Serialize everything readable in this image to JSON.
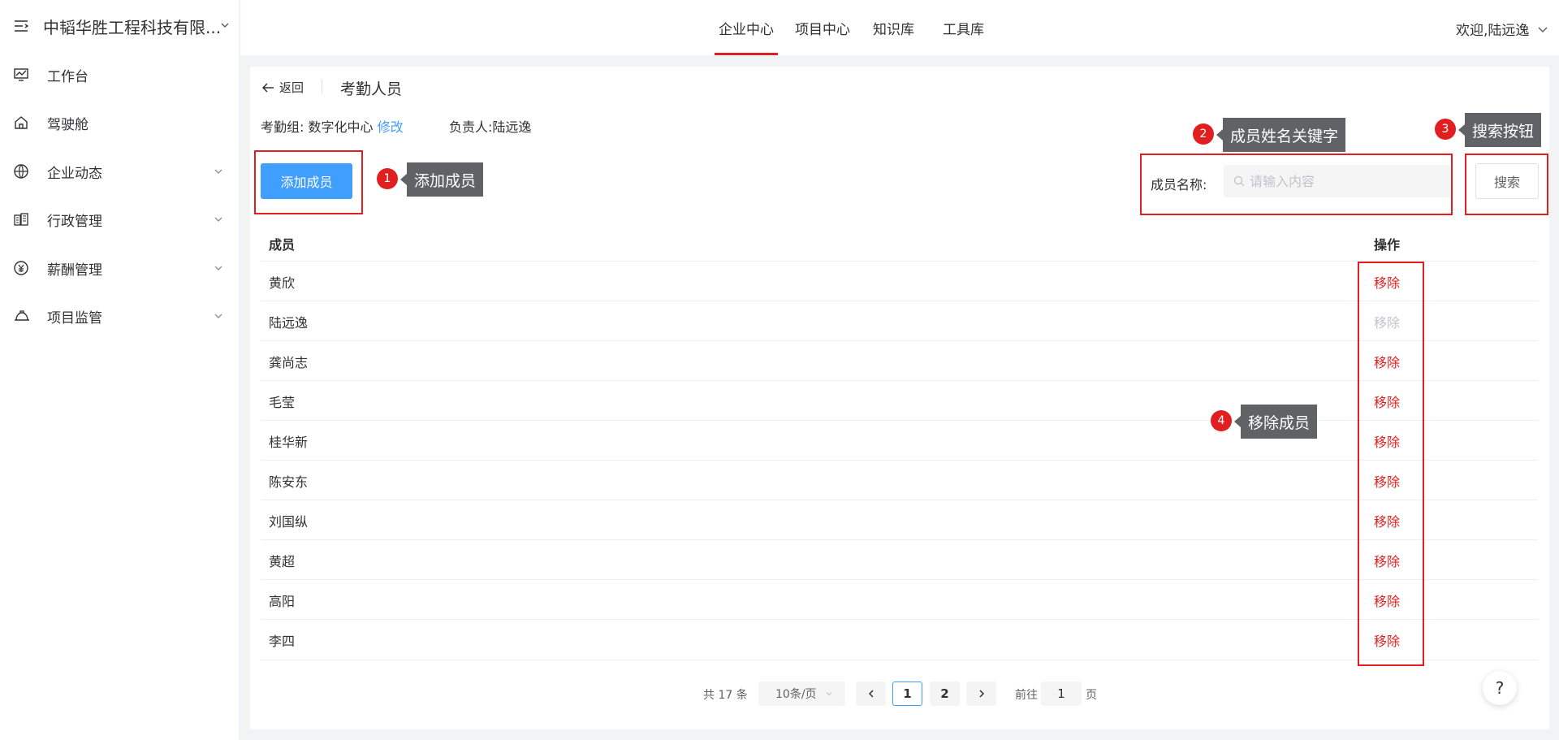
{
  "company": {
    "name": "中韬华胜工程科技有限..."
  },
  "sidebar": {
    "items": [
      {
        "label": "工作台",
        "icon": "monitor-chart-icon",
        "expandable": false
      },
      {
        "label": "驾驶舱",
        "icon": "home-icon",
        "expandable": false
      },
      {
        "label": "企业动态",
        "icon": "globe-icon",
        "expandable": true
      },
      {
        "label": "行政管理",
        "icon": "building-icon",
        "expandable": true
      },
      {
        "label": "薪酬管理",
        "icon": "salary-icon",
        "expandable": true
      },
      {
        "label": "项目监管",
        "icon": "hard-hat-icon",
        "expandable": true
      }
    ]
  },
  "topnav": {
    "tabs": [
      {
        "label": "企业中心",
        "active": true
      },
      {
        "label": "项目中心",
        "active": false
      },
      {
        "label": "知识库",
        "active": false
      },
      {
        "label": "工具库",
        "active": false
      }
    ],
    "welcome": "欢迎,陆远逸"
  },
  "header": {
    "back": "返回",
    "title": "考勤人员"
  },
  "info": {
    "group_label": "考勤组:",
    "group_value": "数字化中心",
    "edit_link": "修改",
    "owner_label": "负责人:",
    "owner_value": "陆远逸"
  },
  "toolbar": {
    "add_button": "添加成员",
    "search_label": "成员名称:",
    "search_placeholder": "请输入内容",
    "search_button": "搜索"
  },
  "table": {
    "columns": {
      "member": "成员",
      "action": "操作"
    },
    "rows": [
      {
        "name": "黄欣",
        "action": "移除",
        "disabled": false
      },
      {
        "name": "陆远逸",
        "action": "移除",
        "disabled": true
      },
      {
        "name": "龚尚志",
        "action": "移除",
        "disabled": false
      },
      {
        "name": "毛莹",
        "action": "移除",
        "disabled": false
      },
      {
        "name": "桂华新",
        "action": "移除",
        "disabled": false
      },
      {
        "name": "陈安东",
        "action": "移除",
        "disabled": false
      },
      {
        "name": "刘国纵",
        "action": "移除",
        "disabled": false
      },
      {
        "name": "黄超",
        "action": "移除",
        "disabled": false
      },
      {
        "name": "高阳",
        "action": "移除",
        "disabled": false
      },
      {
        "name": "李四",
        "action": "移除",
        "disabled": false
      }
    ]
  },
  "pagination": {
    "total_text": "共 17 条",
    "page_size": "10条/页",
    "pages": [
      "1",
      "2"
    ],
    "current": "1",
    "goto_label": "前往",
    "goto_value": "1",
    "goto_unit": "页"
  },
  "help": {
    "label": "?"
  },
  "annotations": [
    {
      "num": "1",
      "text": "添加成员"
    },
    {
      "num": "2",
      "text": "成员姓名关键字"
    },
    {
      "num": "3",
      "text": "搜索按钮"
    },
    {
      "num": "4",
      "text": "移除成员"
    }
  ],
  "colors": {
    "accent": "#409eff",
    "danger": "#e02020",
    "annotation_tip": "#606266"
  }
}
